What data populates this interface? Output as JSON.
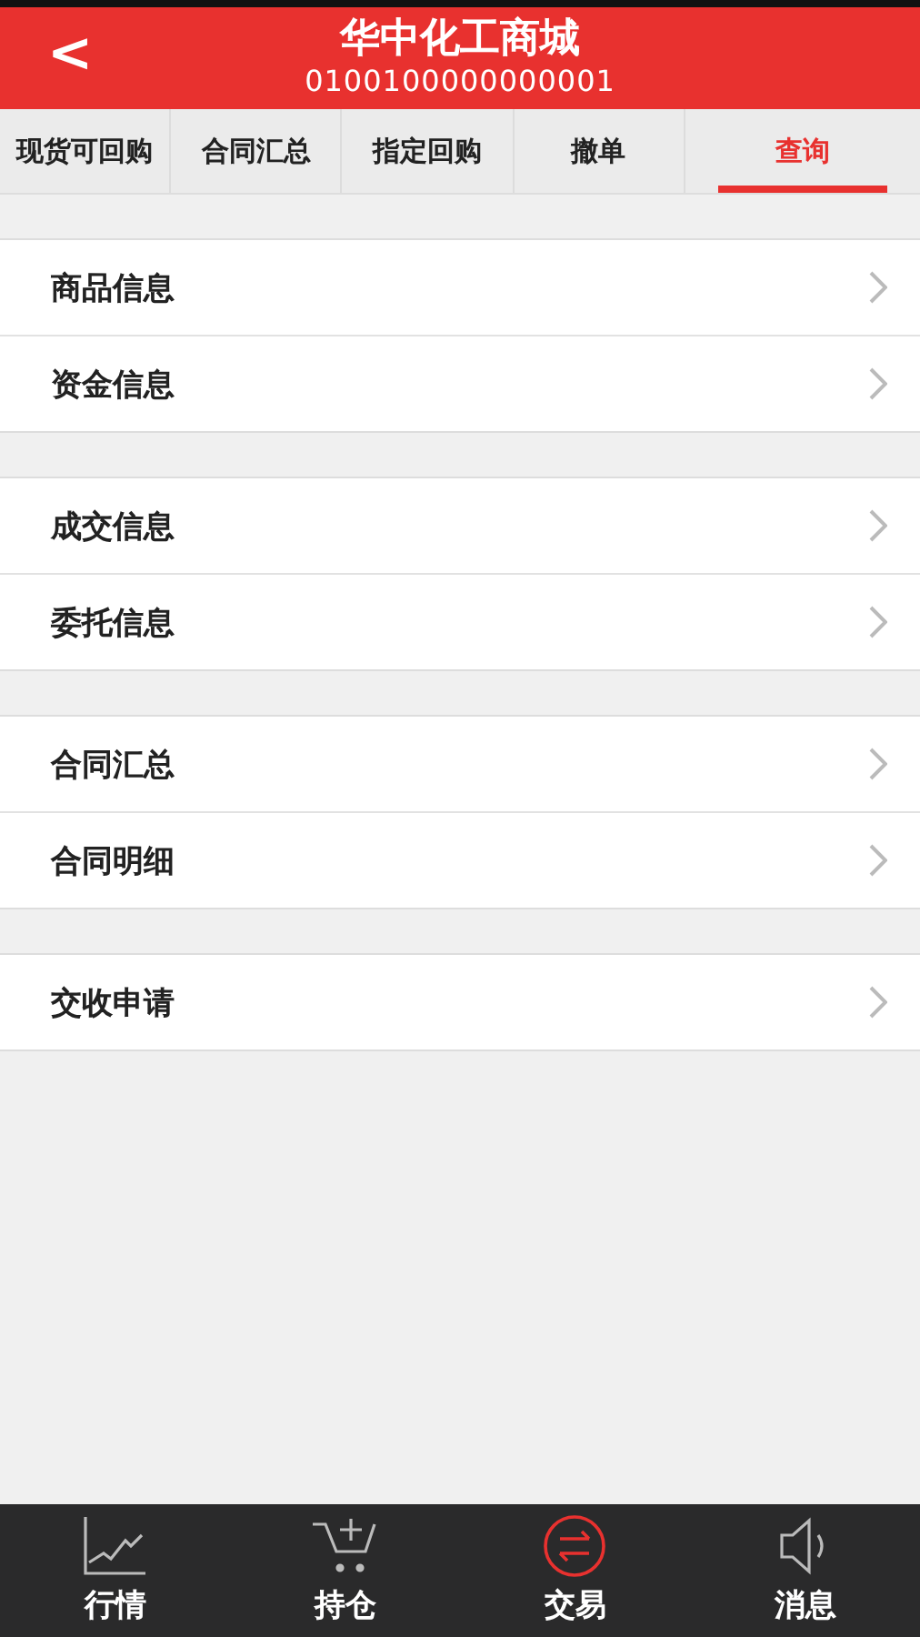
{
  "header": {
    "back": "<",
    "title": "华中化工商城",
    "account": "0100100000000001"
  },
  "tabs": [
    {
      "label": "现货可回购",
      "selected": false
    },
    {
      "label": "合同汇总",
      "selected": false
    },
    {
      "label": "指定回购",
      "selected": false
    },
    {
      "label": "撤单",
      "selected": false
    },
    {
      "label": "查询",
      "selected": true
    }
  ],
  "groups": [
    {
      "items": [
        "商品信息",
        "资金信息"
      ]
    },
    {
      "items": [
        "成交信息",
        "委托信息"
      ]
    },
    {
      "items": [
        "合同汇总",
        "合同明细"
      ]
    },
    {
      "items": [
        "交收申请"
      ]
    }
  ],
  "nav": [
    {
      "kind": "chart",
      "label": "行情",
      "selected": false
    },
    {
      "kind": "cart",
      "label": "持仓",
      "selected": false
    },
    {
      "kind": "trade",
      "label": "交易",
      "selected": true
    },
    {
      "kind": "speaker",
      "label": "消息",
      "selected": false
    }
  ]
}
